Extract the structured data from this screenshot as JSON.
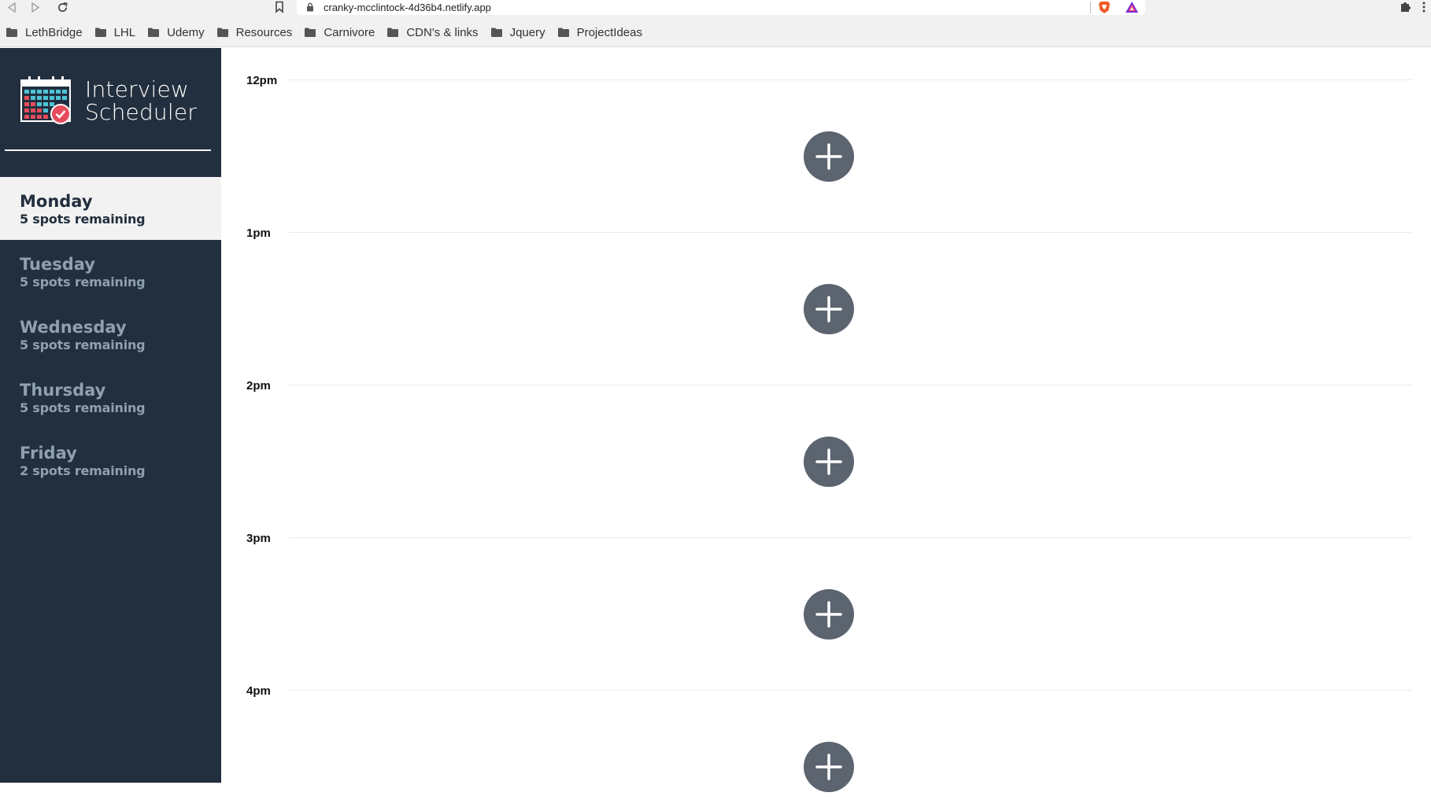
{
  "browser": {
    "url": "cranky-mcclintock-4d36b4.netlify.app",
    "bookmarks": [
      "LethBridge",
      "LHL",
      "Udemy",
      "Resources",
      "Carnivore",
      "CDN's & links",
      "Jquery",
      "ProjectIdeas"
    ]
  },
  "app": {
    "logo_line1": "Interview",
    "logo_line2": "Scheduler"
  },
  "days": [
    {
      "name": "Monday",
      "spots": "5 spots remaining",
      "selected": true
    },
    {
      "name": "Tuesday",
      "spots": "5 spots remaining",
      "selected": false
    },
    {
      "name": "Wednesday",
      "spots": "5 spots remaining",
      "selected": false
    },
    {
      "name": "Thursday",
      "spots": "5 spots remaining",
      "selected": false
    },
    {
      "name": "Friday",
      "spots": "2 spots remaining",
      "selected": false
    }
  ],
  "slots": [
    "12pm",
    "1pm",
    "2pm",
    "3pm",
    "4pm"
  ],
  "colors": {
    "sidebar": "#222f3e",
    "selected_day_bg": "#f2f2f2",
    "inactive_day_text": "#8fa0b1",
    "add_button": "#5c6470"
  }
}
